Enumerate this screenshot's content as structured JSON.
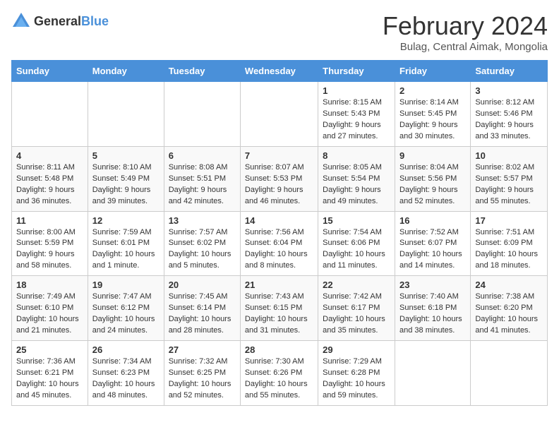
{
  "header": {
    "logo_general": "General",
    "logo_blue": "Blue",
    "month_title": "February 2024",
    "location": "Bulag, Central Aimak, Mongolia"
  },
  "days_of_week": [
    "Sunday",
    "Monday",
    "Tuesday",
    "Wednesday",
    "Thursday",
    "Friday",
    "Saturday"
  ],
  "weeks": [
    [
      {
        "day": "",
        "info": ""
      },
      {
        "day": "",
        "info": ""
      },
      {
        "day": "",
        "info": ""
      },
      {
        "day": "",
        "info": ""
      },
      {
        "day": "1",
        "info": "Sunrise: 8:15 AM\nSunset: 5:43 PM\nDaylight: 9 hours and 27 minutes."
      },
      {
        "day": "2",
        "info": "Sunrise: 8:14 AM\nSunset: 5:45 PM\nDaylight: 9 hours and 30 minutes."
      },
      {
        "day": "3",
        "info": "Sunrise: 8:12 AM\nSunset: 5:46 PM\nDaylight: 9 hours and 33 minutes."
      }
    ],
    [
      {
        "day": "4",
        "info": "Sunrise: 8:11 AM\nSunset: 5:48 PM\nDaylight: 9 hours and 36 minutes."
      },
      {
        "day": "5",
        "info": "Sunrise: 8:10 AM\nSunset: 5:49 PM\nDaylight: 9 hours and 39 minutes."
      },
      {
        "day": "6",
        "info": "Sunrise: 8:08 AM\nSunset: 5:51 PM\nDaylight: 9 hours and 42 minutes."
      },
      {
        "day": "7",
        "info": "Sunrise: 8:07 AM\nSunset: 5:53 PM\nDaylight: 9 hours and 46 minutes."
      },
      {
        "day": "8",
        "info": "Sunrise: 8:05 AM\nSunset: 5:54 PM\nDaylight: 9 hours and 49 minutes."
      },
      {
        "day": "9",
        "info": "Sunrise: 8:04 AM\nSunset: 5:56 PM\nDaylight: 9 hours and 52 minutes."
      },
      {
        "day": "10",
        "info": "Sunrise: 8:02 AM\nSunset: 5:57 PM\nDaylight: 9 hours and 55 minutes."
      }
    ],
    [
      {
        "day": "11",
        "info": "Sunrise: 8:00 AM\nSunset: 5:59 PM\nDaylight: 9 hours and 58 minutes."
      },
      {
        "day": "12",
        "info": "Sunrise: 7:59 AM\nSunset: 6:01 PM\nDaylight: 10 hours and 1 minute."
      },
      {
        "day": "13",
        "info": "Sunrise: 7:57 AM\nSunset: 6:02 PM\nDaylight: 10 hours and 5 minutes."
      },
      {
        "day": "14",
        "info": "Sunrise: 7:56 AM\nSunset: 6:04 PM\nDaylight: 10 hours and 8 minutes."
      },
      {
        "day": "15",
        "info": "Sunrise: 7:54 AM\nSunset: 6:06 PM\nDaylight: 10 hours and 11 minutes."
      },
      {
        "day": "16",
        "info": "Sunrise: 7:52 AM\nSunset: 6:07 PM\nDaylight: 10 hours and 14 minutes."
      },
      {
        "day": "17",
        "info": "Sunrise: 7:51 AM\nSunset: 6:09 PM\nDaylight: 10 hours and 18 minutes."
      }
    ],
    [
      {
        "day": "18",
        "info": "Sunrise: 7:49 AM\nSunset: 6:10 PM\nDaylight: 10 hours and 21 minutes."
      },
      {
        "day": "19",
        "info": "Sunrise: 7:47 AM\nSunset: 6:12 PM\nDaylight: 10 hours and 24 minutes."
      },
      {
        "day": "20",
        "info": "Sunrise: 7:45 AM\nSunset: 6:14 PM\nDaylight: 10 hours and 28 minutes."
      },
      {
        "day": "21",
        "info": "Sunrise: 7:43 AM\nSunset: 6:15 PM\nDaylight: 10 hours and 31 minutes."
      },
      {
        "day": "22",
        "info": "Sunrise: 7:42 AM\nSunset: 6:17 PM\nDaylight: 10 hours and 35 minutes."
      },
      {
        "day": "23",
        "info": "Sunrise: 7:40 AM\nSunset: 6:18 PM\nDaylight: 10 hours and 38 minutes."
      },
      {
        "day": "24",
        "info": "Sunrise: 7:38 AM\nSunset: 6:20 PM\nDaylight: 10 hours and 41 minutes."
      }
    ],
    [
      {
        "day": "25",
        "info": "Sunrise: 7:36 AM\nSunset: 6:21 PM\nDaylight: 10 hours and 45 minutes."
      },
      {
        "day": "26",
        "info": "Sunrise: 7:34 AM\nSunset: 6:23 PM\nDaylight: 10 hours and 48 minutes."
      },
      {
        "day": "27",
        "info": "Sunrise: 7:32 AM\nSunset: 6:25 PM\nDaylight: 10 hours and 52 minutes."
      },
      {
        "day": "28",
        "info": "Sunrise: 7:30 AM\nSunset: 6:26 PM\nDaylight: 10 hours and 55 minutes."
      },
      {
        "day": "29",
        "info": "Sunrise: 7:29 AM\nSunset: 6:28 PM\nDaylight: 10 hours and 59 minutes."
      },
      {
        "day": "",
        "info": ""
      },
      {
        "day": "",
        "info": ""
      }
    ]
  ]
}
